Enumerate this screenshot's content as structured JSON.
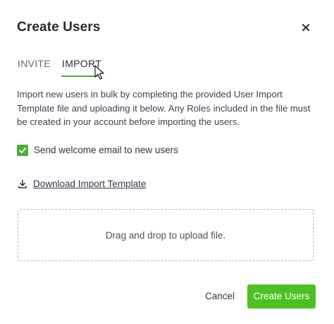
{
  "dialog": {
    "title": "Create Users",
    "close_icon": "close-icon"
  },
  "tabs": [
    {
      "label": "INVITE",
      "active": false
    },
    {
      "label": "IMPORT",
      "active": true
    }
  ],
  "description": "Import new users in bulk by completing the provided User Import Template file and uploading it below. Any Roles included in the file must be created in your account before importing the users.",
  "welcome_email": {
    "label": "Send welcome email to new users",
    "checked": true
  },
  "download": {
    "icon": "download-icon",
    "label": "Download Import Template"
  },
  "dropzone": {
    "label": "Drag and drop to upload file."
  },
  "footer": {
    "cancel_label": "Cancel",
    "create_label": "Create Users"
  },
  "colors": {
    "accent": "#4cc022",
    "checkbox": "#49b035",
    "tab_underline": "#4ab23a",
    "dropzone_border": "#aab6c4"
  }
}
